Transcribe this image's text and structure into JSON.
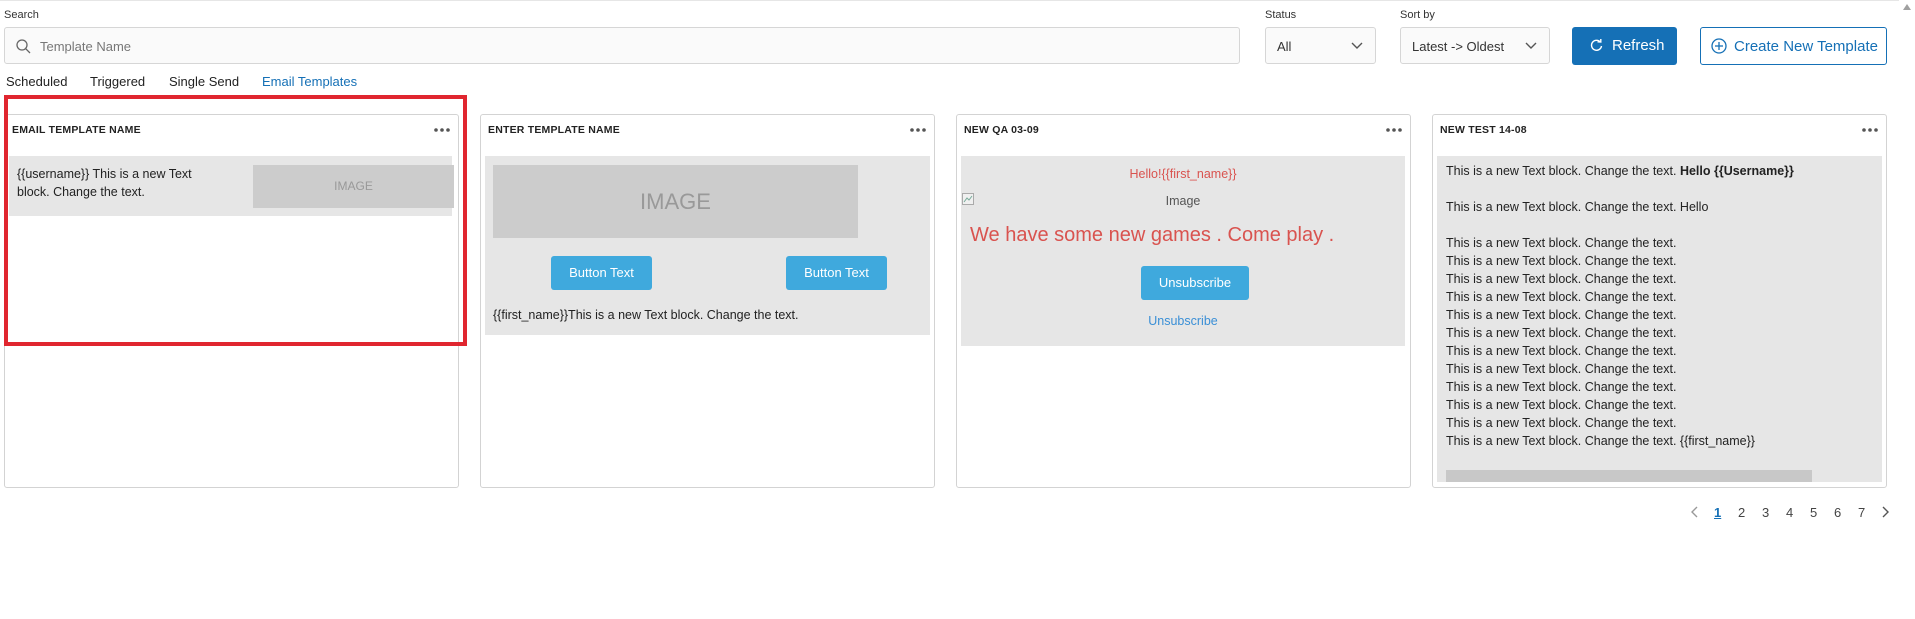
{
  "filters": {
    "search_label": "Search",
    "search_placeholder": "Template Name",
    "status_label": "Status",
    "status_value": "All",
    "sort_label": "Sort by",
    "sort_value": "Latest -> Oldest",
    "refresh_label": "Refresh",
    "create_label": "Create New Template"
  },
  "tabs": [
    {
      "label": "Scheduled"
    },
    {
      "label": "Triggered"
    },
    {
      "label": "Single Send"
    },
    {
      "label": "Email Templates",
      "active": true
    }
  ],
  "cards": [
    {
      "title": "EMAIL TEMPLATE NAME",
      "text": "{{username}} This is a new Text block. Change the text.",
      "text_line1": "{{username}} This is a new Text",
      "text_line2": "block. Change the text.",
      "image_label": "IMAGE"
    },
    {
      "title": "ENTER TEMPLATE NAME",
      "image_label": "IMAGE",
      "button1": "Button Text",
      "button2": "Button Text",
      "text": "{{first_name}}This is a new Text block. Change the text."
    },
    {
      "title": "NEW QA 03-09",
      "greeting": "Hello!{{first_name}}",
      "image_alt": "Image",
      "headline": "We have some new games . Come play .",
      "button": "Unsubscribe",
      "link": "Unsubscribe"
    },
    {
      "title": "NEW TEST 14-08",
      "line1_plain": "This is a new Text block. Change the text.",
      "line1_bold": "Hello {{Username}}",
      "line2": "This is a new Text block. Change the text. Hello",
      "repeat_line": "This is a new Text block. Change the text.",
      "last_line": "This is a new Text block. Change the text. {{first_name}}"
    }
  ],
  "pagination": {
    "pages": [
      "1",
      "2",
      "3",
      "4",
      "5",
      "6",
      "7"
    ],
    "current": "1"
  },
  "colors": {
    "accent": "#1570b6",
    "highlight": "#e0262f",
    "button": "#3fa9dd",
    "headline": "#d9534f"
  }
}
